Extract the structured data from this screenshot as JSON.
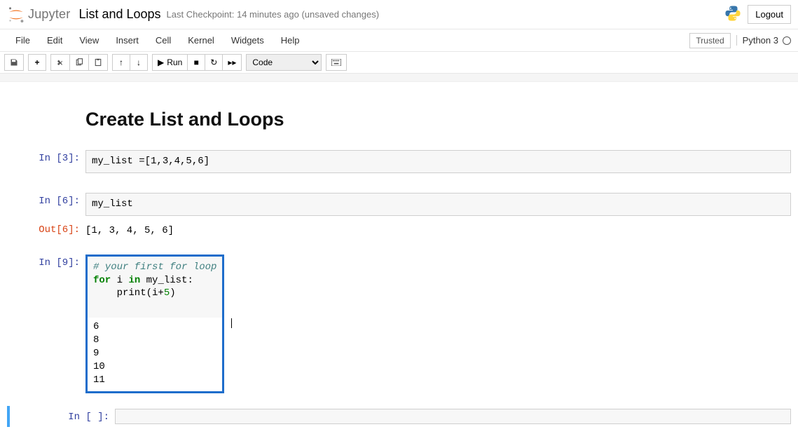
{
  "header": {
    "logo_text": "Jupyter",
    "notebook_name": "List and Loops",
    "checkpoint": "Last Checkpoint: 14 minutes ago  (unsaved changes)",
    "logout": "Logout"
  },
  "menubar": {
    "items": [
      "File",
      "Edit",
      "View",
      "Insert",
      "Cell",
      "Kernel",
      "Widgets",
      "Help"
    ],
    "trusted": "Trusted",
    "kernel": "Python 3"
  },
  "toolbar": {
    "run_label": "Run",
    "celltype": "Code"
  },
  "cells": {
    "markdown_title": "Create List and Loops",
    "c1": {
      "prompt": "In [3]:",
      "code": "my_list =[1,3,4,5,6]"
    },
    "c2": {
      "prompt": "In [6]:",
      "code": "my_list",
      "out_prompt": "Out[6]:",
      "output": "[1, 3, 4, 5, 6]"
    },
    "c3": {
      "prompt": "In [9]:",
      "code_line1": "# your first for loop",
      "code_line2_a": "for",
      "code_line2_b": " i ",
      "code_line2_c": "in",
      "code_line2_d": " my_list:",
      "code_line3_a": "    print(i+",
      "code_line3_b": "5",
      "code_line3_c": ")",
      "output": "6\n8\n9\n10\n11"
    },
    "c4": {
      "prompt": "In [ ]:"
    }
  }
}
